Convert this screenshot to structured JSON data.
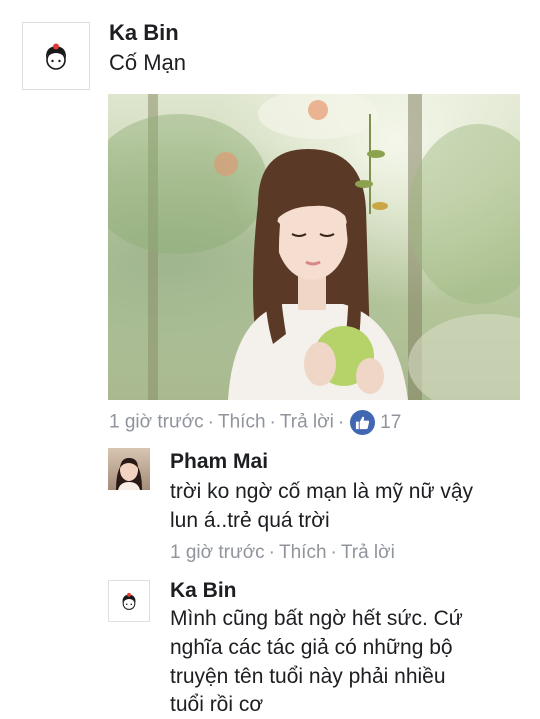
{
  "comment": {
    "author": "Ka Bin",
    "text": "Cố Mạn",
    "meta": {
      "time": "1 giờ trước",
      "like": "Thích",
      "reply": "Trả lời",
      "reactions": "17"
    }
  },
  "reply1": {
    "author": "Pham Mai",
    "text_line1": "trời ko ngờ cố mạn là mỹ nữ vậy",
    "text_line2": "lun á..trẻ quá trời",
    "meta": {
      "time": "1 giờ trước",
      "like": "Thích",
      "reply": "Trả lời"
    }
  },
  "reply2": {
    "author": "Ka Bin",
    "text_line1": "Mình cũng bất ngờ hết sức. Cứ",
    "text_line2": "nghĩa các tác giả có những bộ",
    "text_line3": "truyện tên tuổi này phải nhiều",
    "text_line4": "tuổi rồi cơ"
  },
  "icons": {
    "like": "thumbs-up-icon",
    "avatar": "cartoon-avatar-icon"
  },
  "colors": {
    "like_blue": "#4267b2",
    "meta_gray": "#90949c"
  }
}
